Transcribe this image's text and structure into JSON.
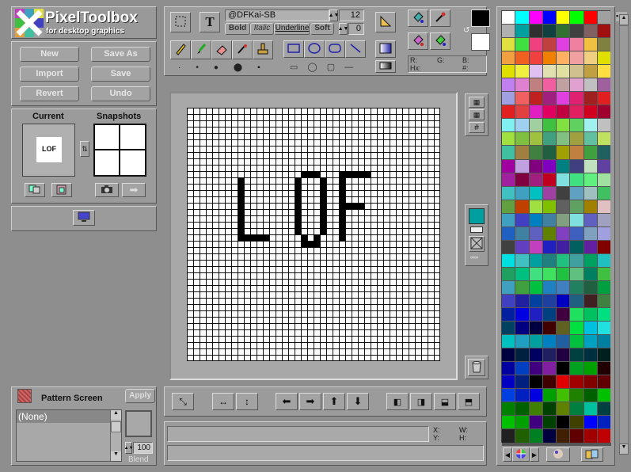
{
  "app": {
    "title": "PixelToolbox",
    "subtitle": "for desktop graphics"
  },
  "file_buttons": {
    "new": "New",
    "save_as": "Save As",
    "import": "Import",
    "save": "Save",
    "revert": "Revert",
    "undo": "Undo"
  },
  "current": {
    "label": "Current",
    "preview_text": "LOF"
  },
  "snapshots": {
    "label": "Snapshots"
  },
  "text_tool": {
    "font": "@DFKai-SB",
    "size": "12",
    "bold": "Bold",
    "italic": "Italic",
    "underline": "Underline",
    "soft": "Soft",
    "spacing": "0"
  },
  "color_info": {
    "r": "R:",
    "g": "G:",
    "b": "B:",
    "hx": "Hx:",
    "hash": "#:"
  },
  "colors": {
    "foreground": "#000000",
    "background": "#ffffff",
    "accent": "#00a0a0"
  },
  "pattern": {
    "title": "Pattern Screen",
    "apply": "Apply",
    "selected": "(None)",
    "blend_value": "100",
    "blend_label": "Blend"
  },
  "status": {
    "x": "X:",
    "y": "Y:",
    "w": "W:",
    "h": "H:"
  },
  "canvas": {
    "pixels_text": "LOF"
  },
  "palette": [
    "#ffffff",
    "#00ffff",
    "#ff00ff",
    "#0000ff",
    "#ffff00",
    "#00ff00",
    "#ff0000",
    "#a0a0a0",
    "#b0b0b0",
    "#00a0a0",
    "#303030",
    "#104040",
    "#307030",
    "#404040",
    "#806060",
    "#a01010",
    "#e0e040",
    "#40e040",
    "#f04080",
    "#c04040",
    "#e040e0",
    "#f080a0",
    "#f0c040",
    "#808040",
    "#f0a040",
    "#f06020",
    "#f04040",
    "#f08000",
    "#ffb060",
    "#f0a0a0",
    "#f0d080",
    "#e0e000",
    "#e0e000",
    "#f0f040",
    "#e0c0f0",
    "#e0e0b0",
    "#e0e0a0",
    "#d0c090",
    "#c0a040",
    "#ffe040",
    "#c080f0",
    "#e080d0",
    "#c08080",
    "#f060a0",
    "#c0a0a0",
    "#e0a0d0",
    "#c0c0c0",
    "#a060a0",
    "#a0a0e0",
    "#f06060",
    "#c02020",
    "#a02080",
    "#e040e0",
    "#e02070",
    "#a02020",
    "#e02020",
    "#e02020",
    "#e04040",
    "#e020c0",
    "#e00060",
    "#c00040",
    "#e02060",
    "#d00020",
    "#a00030",
    "#80f0f0",
    "#a0d0f0",
    "#a0d0a0",
    "#40c040",
    "#80e040",
    "#60d060",
    "#a0f0f0",
    "#c0c0c0",
    "#a0e040",
    "#80c040",
    "#a0c040",
    "#40a080",
    "#80c080",
    "#a0a040",
    "#60c0a0",
    "#c0e060",
    "#40c0a0",
    "#a08040",
    "#408040",
    "#206040",
    "#a0a000",
    "#c08040",
    "#40a040",
    "#206060",
    "#a000a0",
    "#c0a0e0",
    "#800080",
    "#8000c0",
    "#008080",
    "#404080",
    "#c0e0c0",
    "#6040a0",
    "#a020a0",
    "#800040",
    "#a02080",
    "#c00020",
    "#80e0e0",
    "#40e080",
    "#60f080",
    "#a0e0a0",
    "#40c0c0",
    "#40a0c0",
    "#00c0c0",
    "#a040a0",
    "#404040",
    "#60a0c0",
    "#a0c0c0",
    "#40c060",
    "#60a040",
    "#c04000",
    "#a0e040",
    "#80c000",
    "#606060",
    "#60a060",
    "#a08000",
    "#e0c0c0",
    "#40a0c0",
    "#4040c0",
    "#0080c0",
    "#4080a0",
    "#80a080",
    "#80e0e0",
    "#6060c0",
    "#a0a0c0",
    "#2060c0",
    "#4080a0",
    "#6060c0",
    "#608000",
    "#8040c0",
    "#4060c0",
    "#80a0c0",
    "#a0a0e0",
    "#404040",
    "#6040c0",
    "#c040c0",
    "#2020c0",
    "#4020a0",
    "#006060",
    "#6020a0",
    "#800000",
    "#00e0e0",
    "#40c0c0",
    "#00a0a0",
    "#208080",
    "#20c080",
    "#40a0a0",
    "#00a060",
    "#20c0c0",
    "#20a060",
    "#00c080",
    "#40e080",
    "#40e060",
    "#20c040",
    "#60c080",
    "#008060",
    "#40c040",
    "#40a0c0",
    "#40a040",
    "#00c040",
    "#2080c0",
    "#4080c0",
    "#208060",
    "#206040",
    "#00a040",
    "#4040c0",
    "#2020a0",
    "#0040a0",
    "#2040a0",
    "#0000c0",
    "#206080",
    "#402020",
    "#408040",
    "#0020a0",
    "#0000e0",
    "#2020c0",
    "#004080",
    "#400040",
    "#20e060",
    "#00c060",
    "#00e080",
    "#004060",
    "#000080",
    "#000040",
    "#400000",
    "#606020",
    "#00e040",
    "#00c0e0",
    "#20e0e0",
    "#00c0c0",
    "#20a0c0",
    "#00a0a0",
    "#0080c0",
    "#2060a0",
    "#00c040",
    "#00a0c0",
    "#0080a0",
    "#000040",
    "#002040",
    "#000060",
    "#202060",
    "#200040",
    "#004040",
    "#003040",
    "#002020",
    "#0000a0",
    "#0040c0",
    "#400080",
    "#8020a0",
    "#000000",
    "#00a020",
    "#00a000",
    "#200000",
    "#0000c0",
    "#002080",
    "#000000",
    "#400000",
    "#e00000",
    "#a00000",
    "#800000",
    "#600000",
    "#0040e0",
    "#0020c0",
    "#0000e0",
    "#00a000",
    "#40c000",
    "#208000",
    "#006000",
    "#00c000",
    "#008000",
    "#006000",
    "#408000",
    "#004000",
    "#608000",
    "#008040",
    "#00c0a0",
    "#004040",
    "#00c000",
    "#00a000",
    "#400080",
    "#004000",
    "#000000",
    "#404000",
    "#0000ff",
    "#0020c0",
    "#202020",
    "#206000",
    "#008020",
    "#000040",
    "#402000",
    "#600000",
    "#a00000",
    "#c00000",
    "#f0a0a0",
    "#c0e0f0",
    "#e060e0",
    "#a020c0",
    "#e0f0a0",
    "#a0c060",
    "#a0e0a0",
    "#408080",
    "#e0c0a0",
    "#404040",
    "#a0a0a0",
    "#00a0a0",
    "#808000",
    "#800000",
    "#404040",
    "#000000",
    "#a0c0c0",
    "#008080",
    "#800080",
    "#000080",
    "#a0a000",
    "#008000",
    "#808000",
    "#000000"
  ]
}
